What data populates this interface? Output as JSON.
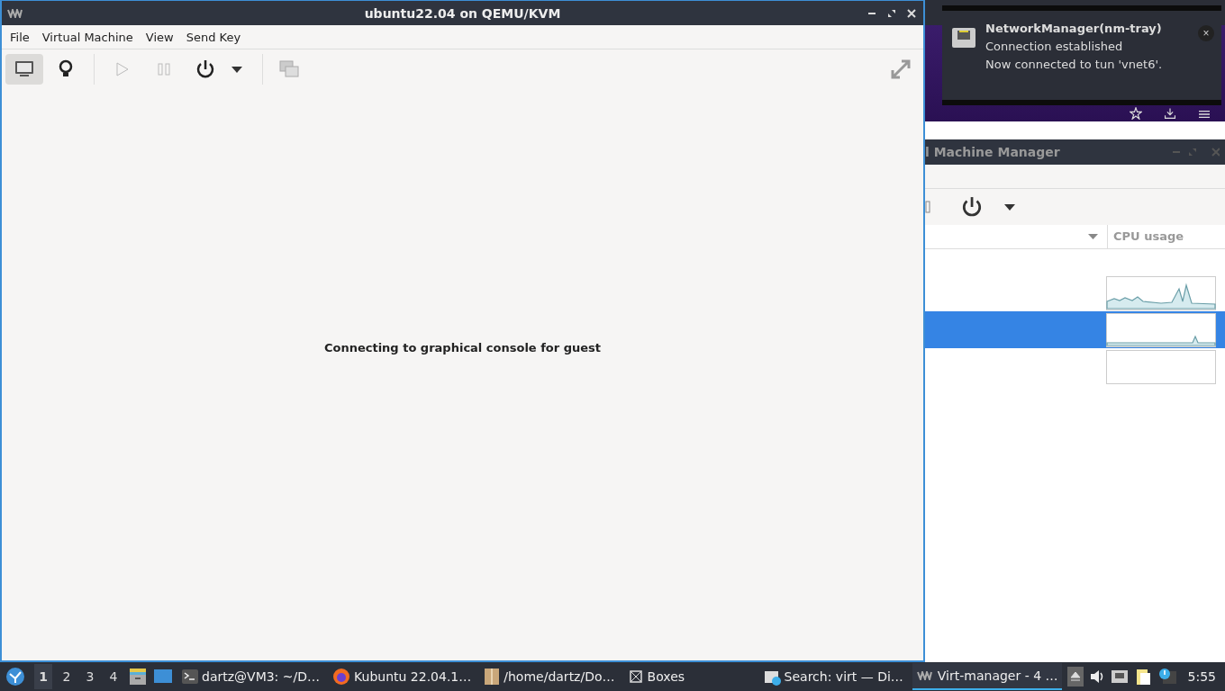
{
  "vm_window": {
    "title": "ubuntu22.04 on QEMU/KVM",
    "menu": [
      "File",
      "Virtual Machine",
      "View",
      "Send Key"
    ],
    "toolbar": [
      {
        "kind": "console",
        "selected": true,
        "disabled": false
      },
      {
        "kind": "details",
        "selected": false,
        "disabled": false
      },
      {
        "kind": "run",
        "selected": false,
        "disabled": true
      },
      {
        "kind": "pause",
        "selected": false,
        "disabled": true
      },
      {
        "kind": "power",
        "selected": false,
        "disabled": false
      }
    ],
    "message": "Connecting to graphical console for guest"
  },
  "manager": {
    "title": "l Machine Manager",
    "column": "CPU usage",
    "rows": [
      {
        "kind": "busy",
        "selected": false
      },
      {
        "kind": "idle",
        "selected": true
      },
      {
        "kind": "empty",
        "selected": false
      }
    ]
  },
  "notification": {
    "app": "NetworkManager(nm-tray)",
    "summary": "Connection established",
    "body": "Now connected to tun 'vnet6'.",
    "close": "×"
  },
  "taskbar": {
    "workspaces": [
      {
        "label": "1",
        "selected": true
      },
      {
        "label": "2",
        "selected": false
      },
      {
        "label": "3",
        "selected": false
      },
      {
        "label": "4",
        "selected": false
      }
    ],
    "tasks": [
      {
        "kind": "terminal",
        "label": "dartz@VM3: ~/D…",
        "selected": false
      },
      {
        "kind": "browser",
        "label": "Kubuntu 22.04.1…",
        "selected": false
      },
      {
        "kind": "folder",
        "label": "/home/dartz/Do…",
        "selected": false
      },
      {
        "kind": "boxes",
        "label": "Boxes",
        "selected": false
      },
      {
        "kind": "store",
        "label": "Search: virt — Di…",
        "selected": false
      },
      {
        "kind": "virt",
        "label": "Virt-manager - 4 …",
        "selected": true
      }
    ],
    "clock": "5:55"
  }
}
